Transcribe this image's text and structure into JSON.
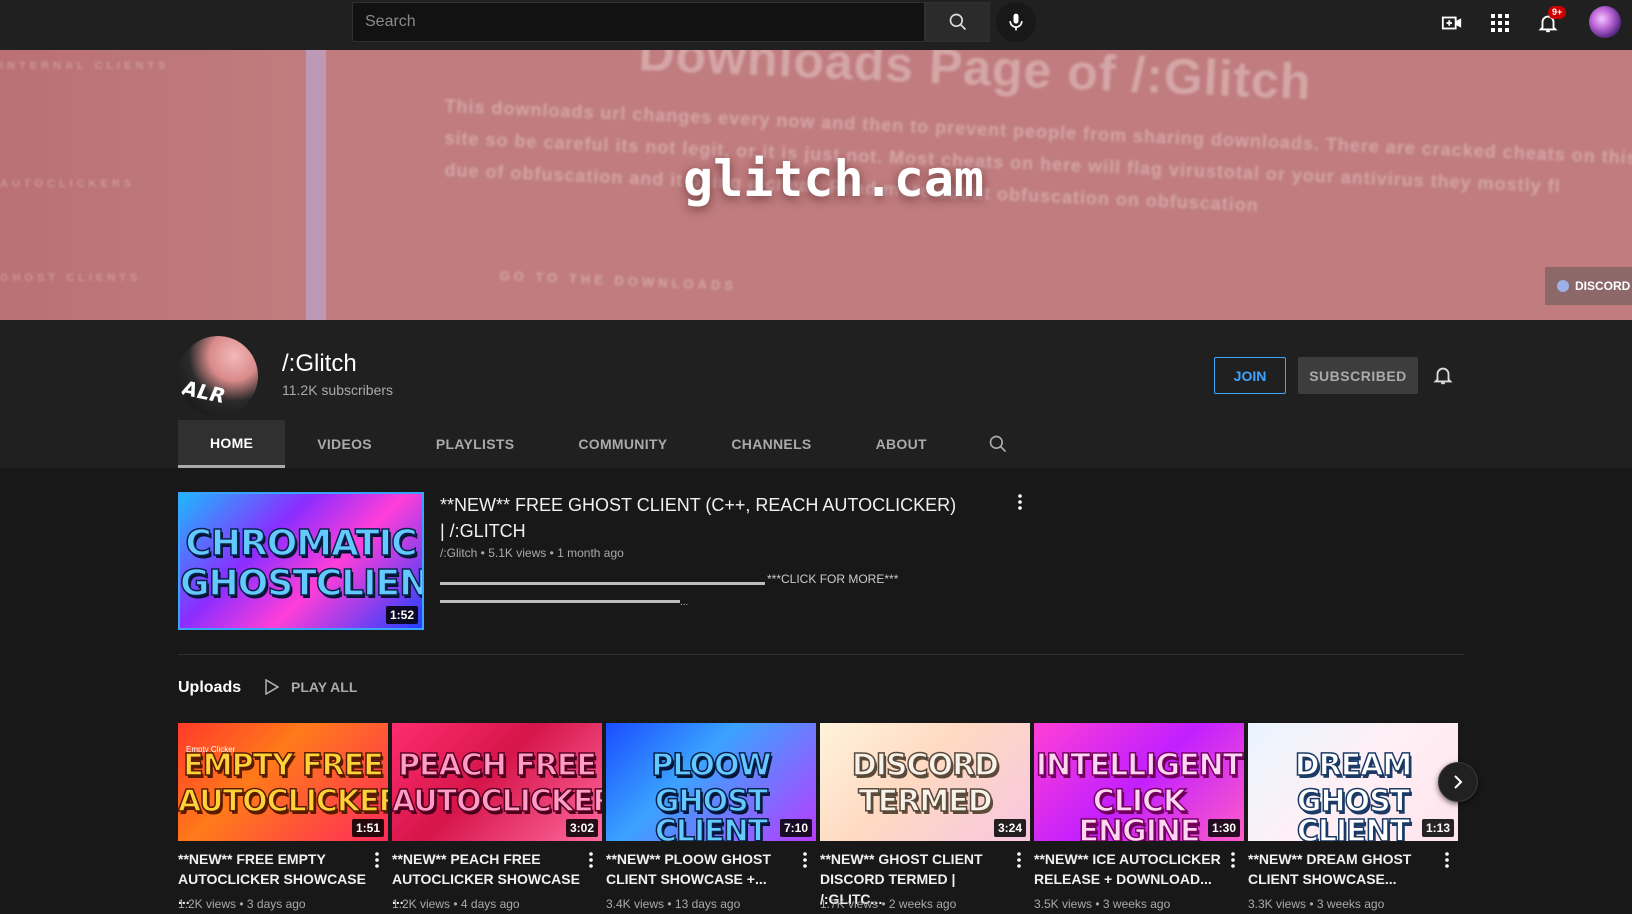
{
  "topbar": {
    "search_placeholder": "Search",
    "notification_count": "9+"
  },
  "banner": {
    "logo_text": "glitch.cam",
    "headline_fragment": "Downloads Page of /:Glitch",
    "body_line1": "This downloads url changes every now and then to prevent people from sharing downloads. There are cracked cheats on this",
    "body_line2": "site so be careful its not legit, or it is just not. Most cheats on here will flag virustotal or your antivirus they mostly fl",
    "body_line3": "due of obfuscation and it being a cheat. Read more about obfuscation on obfuscation",
    "cta": "GO TO THE DOWNLOADS",
    "side_labels": [
      "INTERNAL CLIENTS",
      "AUTOCLICKERS",
      "GHOST CLIENTS"
    ],
    "discord_label": "DISCORD"
  },
  "channel": {
    "avatar_text": "ALR",
    "name": "/:Glitch",
    "subscribers": "11.2K subscribers",
    "join_label": "JOIN",
    "subscribed_label": "SUBSCRIBED"
  },
  "tabs": [
    {
      "label": "HOME",
      "active": true
    },
    {
      "label": "VIDEOS",
      "active": false
    },
    {
      "label": "PLAYLISTS",
      "active": false
    },
    {
      "label": "COMMUNITY",
      "active": false
    },
    {
      "label": "CHANNELS",
      "active": false
    },
    {
      "label": "ABOUT",
      "active": false
    }
  ],
  "featured": {
    "thumb_line1": "CHROMATIC",
    "thumb_line2": "GHOSTCLIENT",
    "duration": "1:52",
    "title": "**NEW** FREE GHOST CLIENT (C++, REACH AUTOCLICKER) | /:GLITCH",
    "meta": "/:Glitch • 5.1K views • 1 month ago",
    "description": "***CLICK FOR MORE***",
    "desc_more": "...",
    "colors": {
      "border": "#3aa3ff"
    }
  },
  "uploads": {
    "label": "Uploads",
    "play_all": "PLAY ALL",
    "videos": [
      {
        "thumb_line1": "EMPTY FREE",
        "thumb_line2": "AUTOCLICKER",
        "thumb_tag": "Empty Clicker",
        "duration": "1:51",
        "title": "**NEW** FREE EMPTY\nAUTOCLICKER SHOWCASE ...",
        "meta": "1.2K views • 3 days ago",
        "style": "t-yellow",
        "bg": "linear-gradient(135deg,#ff3b2a 0%,#ff7a1a 40%,#ff2a5a 100%)"
      },
      {
        "thumb_line1": "PEACH FREE",
        "thumb_line2": "AUTOCLICKER",
        "duration": "3:02",
        "title": "**NEW** PEACH FREE\nAUTOCLICKER SHOWCASE ...",
        "meta": "1.2K views • 4 days ago",
        "style": "t-pink",
        "bg": "linear-gradient(135deg,#ff2d6e 0%,#d6154a 45%,#ff6aa0 100%)"
      },
      {
        "thumb_line1": "PLOOW",
        "thumb_line2": "GHOST CLIENT",
        "duration": "7:10",
        "title": "**NEW** PLOOW GHOST\nCLIENT SHOWCASE +...",
        "meta": "3.4K views • 13 days ago",
        "style": "t-blue",
        "bg": "linear-gradient(135deg,#1a4dff 0%,#3aa3ff 40%,#b93cff 100%)"
      },
      {
        "thumb_line1": "DISCORD",
        "thumb_line2": "TERMED",
        "duration": "3:24",
        "title": "**NEW** GHOST CLIENT\nDISCORD TERMED | /:GLITC...",
        "meta": "1.7K views • 2 weeks ago",
        "style": "t-white",
        "bg": "linear-gradient(135deg,#fff3dc 0%,#ffd9c2 45%,#f7c6e0 100%)"
      },
      {
        "thumb_line1": "INTELLIGENT",
        "thumb_line2": "CLICK ENGINE",
        "duration": "1:30",
        "title": "**NEW** ICE AUTOCLICKER\nRELEASE + DOWNLOAD...",
        "meta": "3.5K views • 3 weeks ago",
        "style": "t-magenta",
        "bg": "linear-gradient(135deg,#ff3fd6 0%,#c21fff 50%,#ff5cc8 100%)"
      },
      {
        "thumb_line1": "DREAM",
        "thumb_line2": "GHOST CLIENT",
        "duration": "1:13",
        "title": "**NEW** DREAM GHOST\nCLIENT SHOWCASE...",
        "meta": "3.3K views • 3 weeks ago",
        "style": "t-white2",
        "bg": "linear-gradient(135deg,#e9f4ff 0%,#fff0f5 50%,#ffe3ec 100%)"
      }
    ]
  }
}
